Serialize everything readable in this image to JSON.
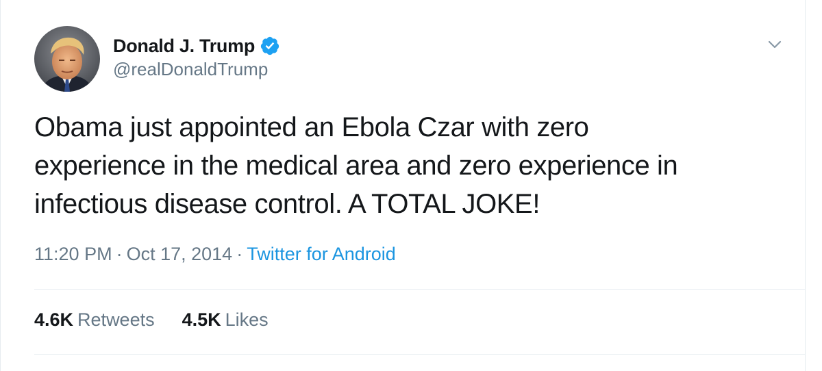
{
  "tweet": {
    "author": {
      "display_name": "Donald J. Trump",
      "handle": "@realDonaldTrump",
      "verified_icon": "verified-badge-icon"
    },
    "text_lines": [
      "Obama just appointed an Ebola Czar with zero",
      "experience in the medical area and zero experience in",
      "infectious disease control. A TOTAL JOKE!"
    ],
    "meta": {
      "time": "11:20 PM",
      "separator": "·",
      "date": "Oct 17, 2014",
      "source": "Twitter for Android"
    },
    "stats": {
      "retweets_count": "4.6K",
      "retweets_label": "Retweets",
      "likes_count": "4.5K",
      "likes_label": "Likes"
    },
    "menu_icon": "chevron-down-icon"
  },
  "colors": {
    "text_primary": "#14171a",
    "text_secondary": "#657786",
    "link": "#1b95e0",
    "verified": "#1da1f2",
    "border": "#e6ecf0"
  }
}
